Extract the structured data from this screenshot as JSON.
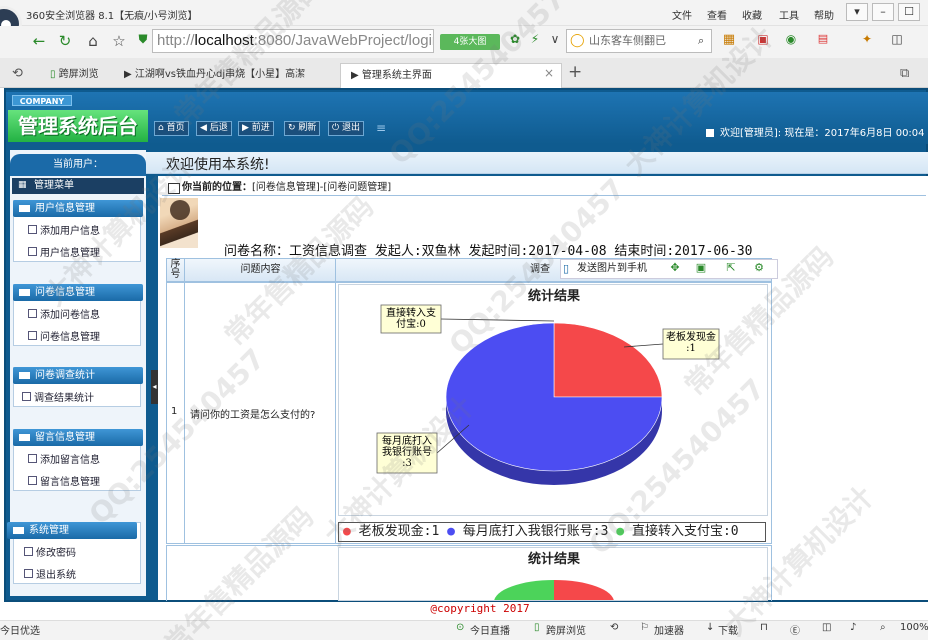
{
  "browser": {
    "title": "360安全浏览器 8.1【无痕/小号浏览】",
    "menu": [
      "文件",
      "查看",
      "收藏",
      "工具",
      "帮助"
    ],
    "url_prefix": "http://",
    "url_host": "localhost",
    "url_rest": ":8080/JavaWebProject/login",
    "image_badge": "4张大图",
    "search_text": "山东客车侧翻已",
    "tabs": [
      {
        "label": "跨屏浏览"
      },
      {
        "label": "江湖啊vs铁血丹心dj串烧【小星】高潔"
      },
      {
        "label": "管理系统主界面"
      }
    ]
  },
  "app": {
    "company": "COMPANY",
    "title": "管理系统后台",
    "toolbar": [
      "首页",
      "后退",
      "前进",
      "刷新",
      "退出"
    ],
    "welcome": "欢迎[管理员]:  现在是：2017年6月8日 00:04",
    "banner": "欢迎使用本系统!"
  },
  "sidebar": {
    "current_user": "当前用户：",
    "menu_title": "管理菜单",
    "groups": [
      {
        "title": "用户信息管理",
        "items": [
          "添加用户信息",
          "用户信息管理"
        ]
      },
      {
        "title": "问卷信息管理",
        "items": [
          "添加问卷信息",
          "问卷信息管理"
        ]
      },
      {
        "title": "问卷调查统计",
        "items": [
          "调查结果统计"
        ]
      },
      {
        "title": "留言信息管理",
        "items": [
          "添加留言信息",
          "留言信息管理"
        ]
      },
      {
        "title": "系统管理",
        "items": [
          "修改密码",
          "退出系统"
        ]
      }
    ]
  },
  "content": {
    "location_label": "你当前的位置：",
    "location_path": "[问卷信息管理]-[问卷问题管理]",
    "questionnaire_info": "问卷名称：工资信息调查  发起人:双鱼林  发起时间:2017-04-08  结束时间:2017-06-30",
    "table_headers": {
      "no": "序号",
      "question": "问题内容",
      "stat": "调查"
    },
    "share_label": "发送图片到手机",
    "rows": [
      {
        "no": "1",
        "question": "请问你的工资是怎么支付的?"
      }
    ],
    "copyright": "@copyright 2017"
  },
  "chart_data": [
    {
      "type": "pie",
      "title": "统计结果",
      "categories": [
        "老板发现金",
        "每月底打入我银行账号",
        "直接转入支付宝"
      ],
      "values": [
        1,
        3,
        0
      ],
      "colors": [
        "#f5484a",
        "#4c4df2",
        "#4cd35a"
      ],
      "data_labels": [
        "老板发现金:1",
        "每月底打入我银行账号:3",
        "直接转入支付宝:0"
      ],
      "legend": [
        "老板发现金:1",
        "每月底打入我银行账号:3",
        "直接转入支付宝:0"
      ],
      "legend_position": "bottom"
    },
    {
      "type": "pie",
      "title": "统计结果"
    }
  ],
  "statusbar": {
    "left": "今日优选",
    "live": "今日直播",
    "cross": "跨屏浏览",
    "accel": "加速器",
    "download": "下载",
    "zoom": "100%"
  },
  "watermarks": [
    "QQ:254540457",
    "常年售精品源码",
    "大神计算机设计"
  ]
}
